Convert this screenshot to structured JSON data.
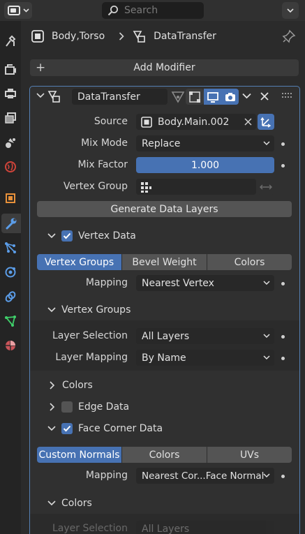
{
  "header": {
    "search_placeholder": "Search"
  },
  "breadcrumb": {
    "object": "Body,Torso",
    "modifier": "DataTransfer"
  },
  "add_modifier_label": "Add Modifier",
  "modifier": {
    "name": "DataTransfer",
    "source_label": "Source",
    "source_value": "Body.Main.002",
    "mix_mode_label": "Mix Mode",
    "mix_mode_value": "Replace",
    "mix_factor_label": "Mix Factor",
    "mix_factor_value": "1.000",
    "mix_factor_fraction": 1.0,
    "vertex_group_label": "Vertex Group",
    "vertex_group_value": "",
    "generate_label": "Generate Data Layers"
  },
  "vertex_data": {
    "title": "Vertex Data",
    "checked": true,
    "tabs": [
      "Vertex Groups",
      "Bevel Weight",
      "Colors"
    ],
    "active_tab": 0,
    "mapping_label": "Mapping",
    "mapping_value": "Nearest Vertex",
    "groups_title": "Vertex Groups",
    "layer_selection_label": "Layer Selection",
    "layer_selection_value": "All Layers",
    "layer_mapping_label": "Layer Mapping",
    "layer_mapping_value": "By Name",
    "colors_title": "Colors"
  },
  "edge_data": {
    "title": "Edge Data",
    "checked": false
  },
  "face_corner": {
    "title": "Face Corner Data",
    "checked": true,
    "tabs": [
      "Custom Normals",
      "Colors",
      "UVs"
    ],
    "active_tab": 0,
    "mapping_label": "Mapping",
    "mapping_value": "Nearest Cor...Face Normal",
    "colors_title": "Colors",
    "layer_selection_label": "Layer Selection",
    "layer_selection_value": "All Layers"
  },
  "colors": {
    "accent": "#4772b3",
    "panel_border": "#5580b4"
  }
}
